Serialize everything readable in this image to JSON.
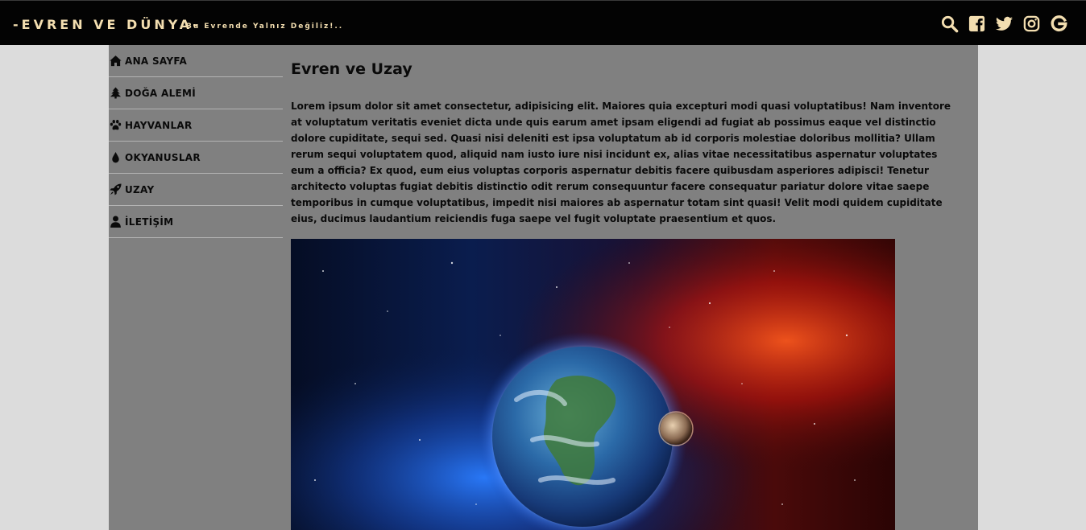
{
  "header": {
    "brand": "-EVREN VE DÜNYA-",
    "tagline": "Bu Evrende Yalnız Değiliz!..",
    "social_icons": [
      "search-icon",
      "facebook-icon",
      "twitter-icon",
      "instagram-icon",
      "google-icon"
    ]
  },
  "colors": {
    "header_bg": "#030303",
    "brand_text": "#f3deb0",
    "page_bg": "#808080",
    "outer_bg": "#dcdcdc",
    "nav_divider": "#b4b4b4",
    "text": "#0a0a0a"
  },
  "sidebar": {
    "items": [
      {
        "label": "ANA SAYFA",
        "icon": "home-icon"
      },
      {
        "label": "DOĞA ALEMİ",
        "icon": "tree-icon"
      },
      {
        "label": "HAYVANLAR",
        "icon": "paw-icon"
      },
      {
        "label": "OKYANUSLAR",
        "icon": "water-drop-icon"
      },
      {
        "label": "UZAY",
        "icon": "rocket-icon"
      },
      {
        "label": "İLETİŞİM",
        "icon": "user-icon"
      }
    ]
  },
  "main": {
    "title": "Evren ve Uzay",
    "body": "Lorem ipsum dolor sit amet consectetur, adipisicing elit. Maiores quia excepturi modi quasi voluptatibus! Nam inventore at voluptatum veritatis eveniet dicta unde quis earum amet ipsam eligendi ad fugiat ab possimus eaque vel distinctio dolore cupiditate, sequi sed. Quasi nisi deleniti est ipsa voluptatum ab id corporis molestiae doloribus mollitia? Ullam rerum sequi voluptatem quod, aliquid nam iusto iure nisi incidunt ex, alias vitae necessitatibus aspernatur voluptates eum a officia? Ex quod, eum eius voluptas corporis aspernatur debitis facere quibusdam asperiores adipisci! Tenetur architecto voluptas fugiat debitis distinctio odit rerum consequuntur facere consequatur pariatur dolore vitae saepe temporibus in cumque voluptatibus, impedit nisi maiores ab aspernatur totam sint quasi! Velit modi quidem cupiditate eius, ducimus laudantium reiciendis fuga saepe vel fugit voluptate praesentium et quos."
  }
}
